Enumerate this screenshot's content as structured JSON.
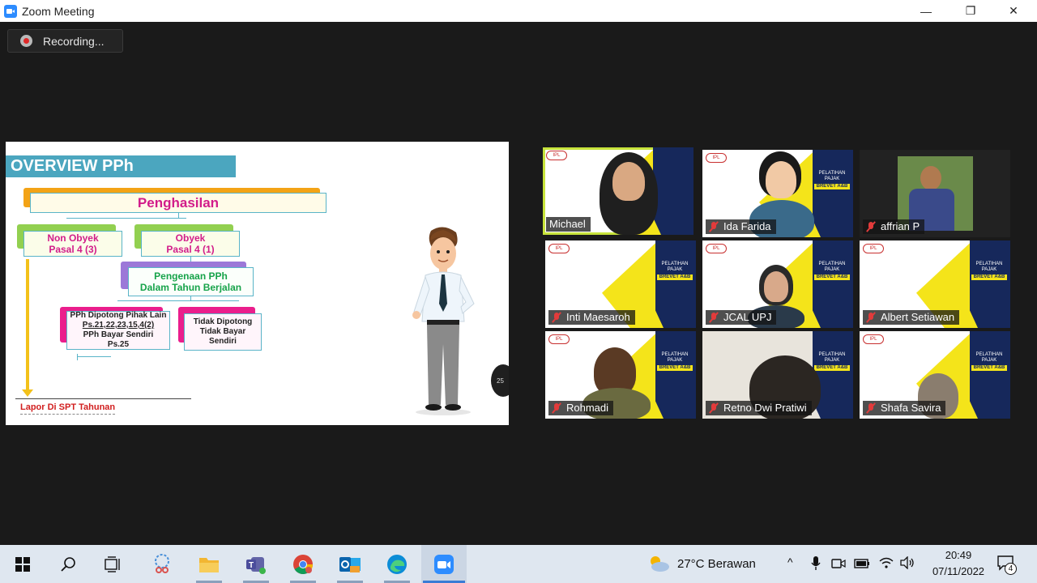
{
  "window": {
    "title": "Zoom Meeting",
    "minimize": "—",
    "restore": "❐",
    "close": "✕"
  },
  "recording": {
    "label": "Recording..."
  },
  "slide": {
    "heading": "OVERVIEW PPh",
    "penghasilan": "Penghasilan",
    "non_obyek": [
      "Non Obyek",
      "Pasal 4 (3)"
    ],
    "obyek": [
      "Obyek",
      "Pasal 4 (1)"
    ],
    "pengenaan": [
      "Pengenaan PPh",
      "Dalam Tahun Berjalan"
    ],
    "dipotong": [
      "PPh Dipotong Pihak Lain",
      "Ps.21,22,23,15,4(2)",
      "PPh Bayar Sendiri",
      "Ps.25"
    ],
    "tidak_dipotong": [
      "Tidak Dipotong",
      "Tidak Bayar",
      "Sendiri"
    ],
    "lapor": "Lapor Di SPT Tahunan",
    "page_number": "25"
  },
  "participants": [
    {
      "name": "Michael",
      "muted": false,
      "active": true
    },
    {
      "name": "Ida Farida",
      "muted": true,
      "active": false
    },
    {
      "name": "affrian P",
      "muted": true,
      "active": false
    },
    {
      "name": "Inti Maesaroh",
      "muted": true,
      "active": false
    },
    {
      "name": "JCAL UPJ",
      "muted": true,
      "active": false
    },
    {
      "name": "Albert Setiawan",
      "muted": true,
      "active": false
    },
    {
      "name": "Rohmadi",
      "muted": true,
      "active": false
    },
    {
      "name": "Retno Dwi Pratiwi",
      "muted": true,
      "active": false
    },
    {
      "name": "Shafa Savira",
      "muted": true,
      "active": false
    }
  ],
  "promo": {
    "line1": "PELATIHAN PAJAK",
    "line2": "BREVET A&B"
  },
  "taskbar": {
    "weather": "27°C  Berawan",
    "time": "20:49",
    "date": "07/11/2022",
    "notifications": "4"
  }
}
